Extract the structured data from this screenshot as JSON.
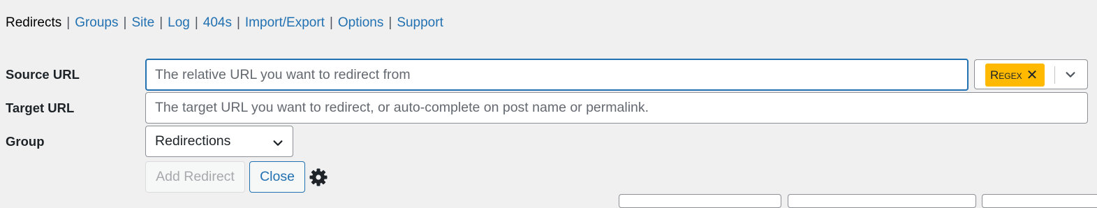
{
  "subnav": {
    "current": "Redirects",
    "links": [
      "Groups",
      "Site",
      "Log",
      "404s",
      "Import/Export",
      "Options",
      "Support"
    ],
    "separator": "|"
  },
  "form": {
    "source": {
      "label": "Source URL",
      "placeholder": "The relative URL you want to redirect from",
      "flag": "Regex",
      "flag_remove": "✕"
    },
    "target": {
      "label": "Target URL",
      "placeholder": "The target URL you want to redirect, or auto-complete on post name or permalink."
    },
    "group": {
      "label": "Group",
      "selected": "Redirections"
    },
    "add_button": "Add Redirect",
    "close_button": "Close"
  },
  "icons": {
    "flag_dropdown": "chevron-down-icon",
    "group_dropdown": "chevron-down-icon",
    "settings": "gear-icon"
  },
  "colors": {
    "link": "#2271b1",
    "focus_border": "#2271b1",
    "tag_bg": "#ffb900",
    "page_bg": "#f0f0f1"
  }
}
